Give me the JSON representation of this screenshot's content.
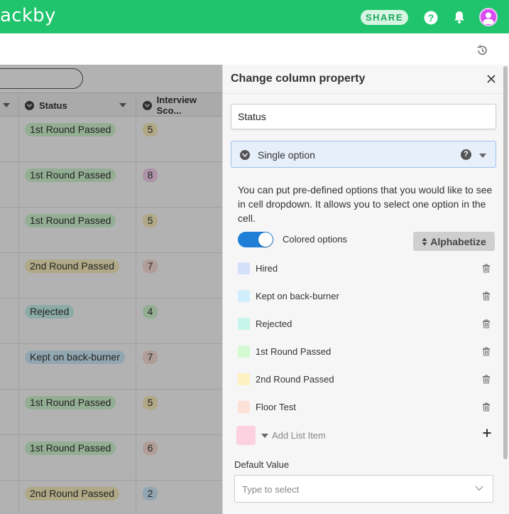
{
  "topbar": {
    "logo_text": "ackby",
    "share_label": "SHARE",
    "help_icon": "question-circle-icon",
    "bell_icon": "bell-icon",
    "avatar_icon": "user-avatar-icon",
    "brand_color": "#1fc46c"
  },
  "toolbar": {
    "history_icon": "history-icon"
  },
  "grid": {
    "columns": [
      {
        "label": ""
      },
      {
        "label": "Status"
      },
      {
        "label": "Interview Sco..."
      }
    ],
    "rows": [
      {
        "status": "1st Round Passed",
        "score": "5"
      },
      {
        "status": "1st Round Passed",
        "score": "8"
      },
      {
        "status": "1st Round Passed",
        "score": "5"
      },
      {
        "status": "2nd Round Passed",
        "score": "7"
      },
      {
        "status": "Rejected",
        "score": "4"
      },
      {
        "status": "Kept on back-burner",
        "score": "7"
      },
      {
        "status": "1st Round Passed",
        "score": "5"
      },
      {
        "status": "1st Round Passed",
        "score": "6"
      },
      {
        "status": "2nd Round Passed",
        "score": "2"
      }
    ]
  },
  "panel": {
    "title": "Change column property",
    "column_name": "Status",
    "column_type": "Single option",
    "type_help": "?",
    "description": "You can put pre-defined options that you would like to see in cell dropdown. It allows you to select one option in the cell.",
    "colored_options_label": "Colored options",
    "colored_options_on": true,
    "alphabetize_label": "Alphabetize",
    "options": [
      {
        "label": "Hired",
        "color": "#d4e0fa"
      },
      {
        "label": "Kept on back-burner",
        "color": "#d0eefc"
      },
      {
        "label": "Rejected",
        "color": "#c8f5eb"
      },
      {
        "label": "1st Round Passed",
        "color": "#d3fad3"
      },
      {
        "label": "2nd Round Passed",
        "color": "#fdf1c1"
      },
      {
        "label": "Floor Test",
        "color": "#fde1d8"
      }
    ],
    "add_item_placeholder": "Add List Item",
    "add_item_color": "#fdd2e0",
    "default_value_label": "Default Value",
    "default_value_placeholder": "Type to select"
  },
  "colors": {
    "status_1st": "#d3fad3",
    "status_2nd": "#fdf1c1",
    "status_rejected": "#c8f5eb",
    "status_backburner": "#d0eefc",
    "toggle_on": "#1f7fd6"
  }
}
